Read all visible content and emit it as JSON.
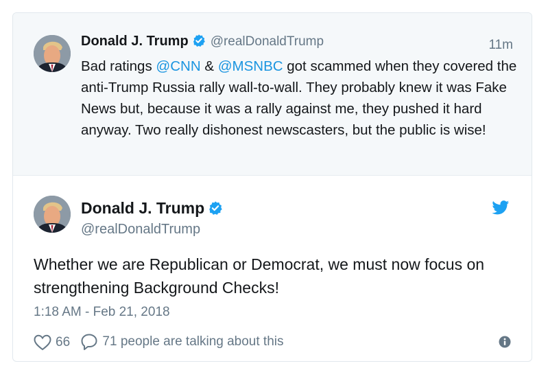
{
  "quoted_tweet": {
    "author_name": "Donald J. Trump",
    "author_handle": "@realDonaldTrump",
    "time": "11m",
    "text": {
      "part1": "Bad ratings ",
      "mention1": "@CNN",
      "part2": " & ",
      "mention2": "@MSNBC",
      "part3": " got scammed when they covered the anti-Trump Russia rally wall-to-wall. They probably knew it was Fake News but, because it was a rally against me, they pushed it hard anyway. Two really dishonest newscasters, but the public is wise!"
    }
  },
  "main_tweet": {
    "author_name": "Donald J. Trump",
    "author_handle": "@realDonaldTrump",
    "text": "Whether we are Republican or Democrat, we must now focus on strengthening Background Checks!",
    "timestamp": "1:18 AM - Feb 21, 2018",
    "likes": "66",
    "talking": "71 people are talking about this"
  },
  "icons": {
    "verified": "verified-badge-icon",
    "bird": "twitter-bird-icon",
    "like": "heart-icon",
    "reply": "speech-bubble-icon",
    "info": "info-icon"
  },
  "colors": {
    "link": "#1b95e0",
    "verified": "#1da1f2",
    "secondary_text": "#657786",
    "quoted_background": "#f5f8fa"
  }
}
